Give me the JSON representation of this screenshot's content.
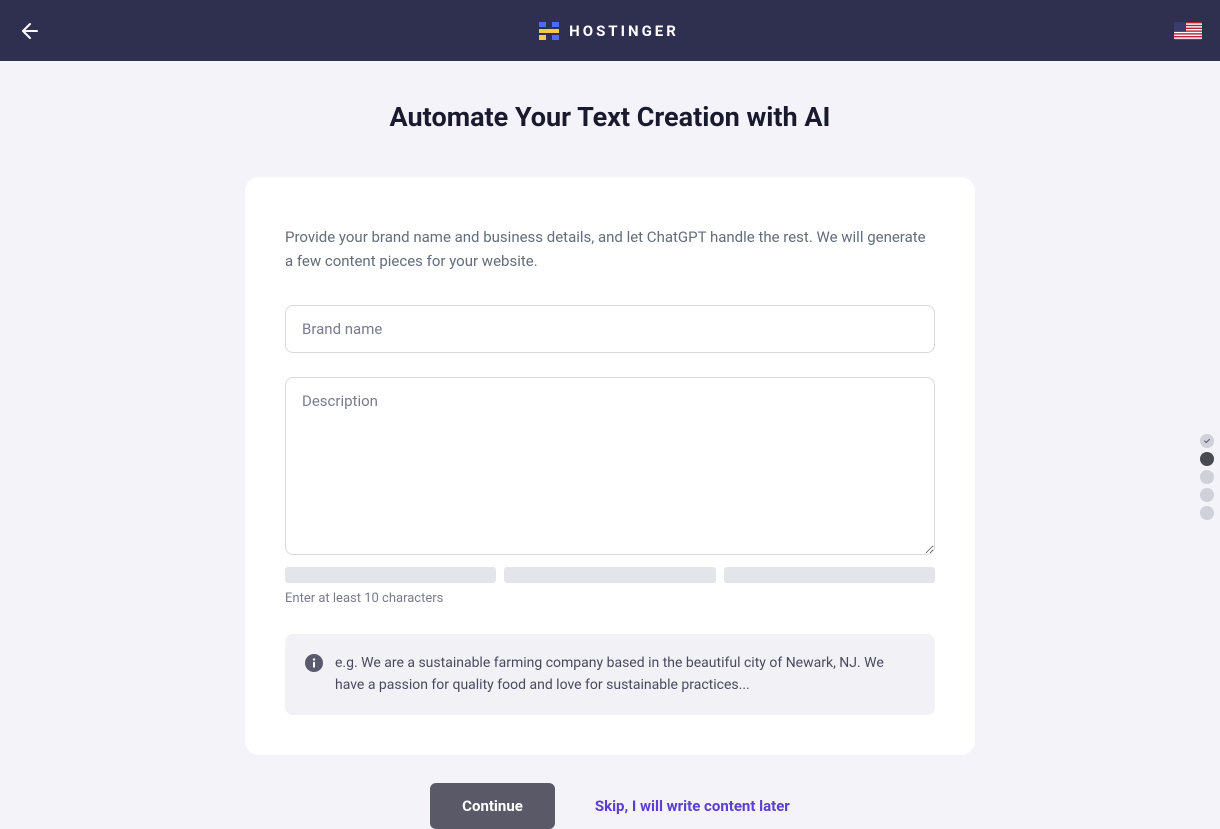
{
  "header": {
    "brand": "HOSTINGER"
  },
  "page": {
    "title": "Automate Your Text Creation with AI"
  },
  "form": {
    "intro": "Provide your brand name and business details, and let ChatGPT handle the rest. We will generate a few content pieces for your website.",
    "brand_placeholder": "Brand name",
    "brand_value": "",
    "desc_placeholder": "Description",
    "desc_value": "",
    "helper": "Enter at least 10 characters",
    "hint": "e.g. We are a sustainable farming company based in the beautiful city of Newark, NJ. We have a passion for quality food and love for sustainable practices..."
  },
  "actions": {
    "continue": "Continue",
    "skip": "Skip, I will write content later"
  },
  "stepper": {
    "total": 5,
    "active": 2
  }
}
